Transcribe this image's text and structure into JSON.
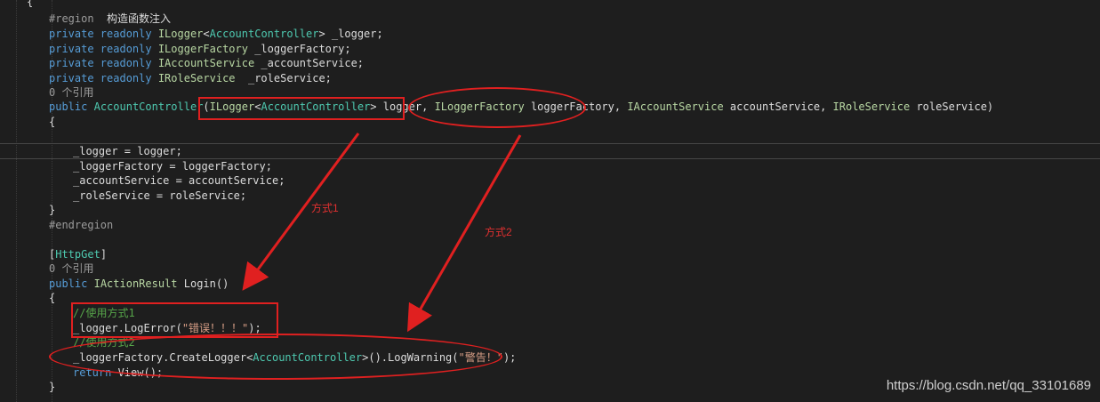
{
  "code": {
    "open_brace": "{",
    "region_kw": "#region",
    "region_name": "构造函数注入",
    "f1": {
      "kw": "private readonly",
      "type": "ILogger",
      "lt": "<",
      "generic": "AccountController",
      "gt": ">",
      "name": " _logger;"
    },
    "f2": {
      "kw": "private readonly",
      "type": "ILoggerFactory",
      "name": " _loggerFactory;"
    },
    "f3": {
      "kw": "private readonly",
      "type": "IAccountService",
      "name": " _accountService;"
    },
    "f4": {
      "kw": "private readonly",
      "type": "IRoleService",
      "name": "  _roleService;"
    },
    "refs1": "0 个引用",
    "ctor": {
      "kw": "public",
      "name": "AccountController",
      "paren_open": "(",
      "p1_type": "ILogger",
      "p1_lt": "<",
      "p1_generic": "AccountController",
      "p1_gt": ">",
      "p1_name": " logger,",
      "p2_type": "ILoggerFactory",
      "p2_name": " loggerFactory,",
      "p3_type": "IAccountService",
      "p3_name": " accountService,",
      "p4_type": "IRoleService",
      "p4_name": " roleService)"
    },
    "ctor_open": "{",
    "assign1": "_logger = logger;",
    "assign2": "_loggerFactory = loggerFactory;",
    "assign3": "_accountService = accountService;",
    "assign4": "_roleService = roleService;",
    "ctor_close": "}",
    "endregion": "#endregion",
    "attr_open": "[",
    "attr_name": "HttpGet",
    "attr_close": "]",
    "refs2": "0 个引用",
    "login": {
      "kw": "public",
      "type": "IActionResult",
      "name": " Login()"
    },
    "login_open": "{",
    "comment1": "//使用方式1",
    "call1_pre": "_logger.LogError(",
    "call1_str": "\"错误！！！\"",
    "call1_post": ");",
    "comment2": "//使用方式2",
    "call2_pre": "_loggerFactory.CreateLogger<",
    "call2_generic": "AccountController",
    "call2_mid": ">().LogWarning(",
    "call2_str": "\"警告！\"",
    "call2_post": ");",
    "return_kw": "return",
    "return_rest": " View();",
    "login_close": "}"
  },
  "annotations": {
    "label1": "方式1",
    "label2": "方式2",
    "color": "#e02020"
  },
  "watermark": "https://blog.csdn.net/qq_33101689"
}
